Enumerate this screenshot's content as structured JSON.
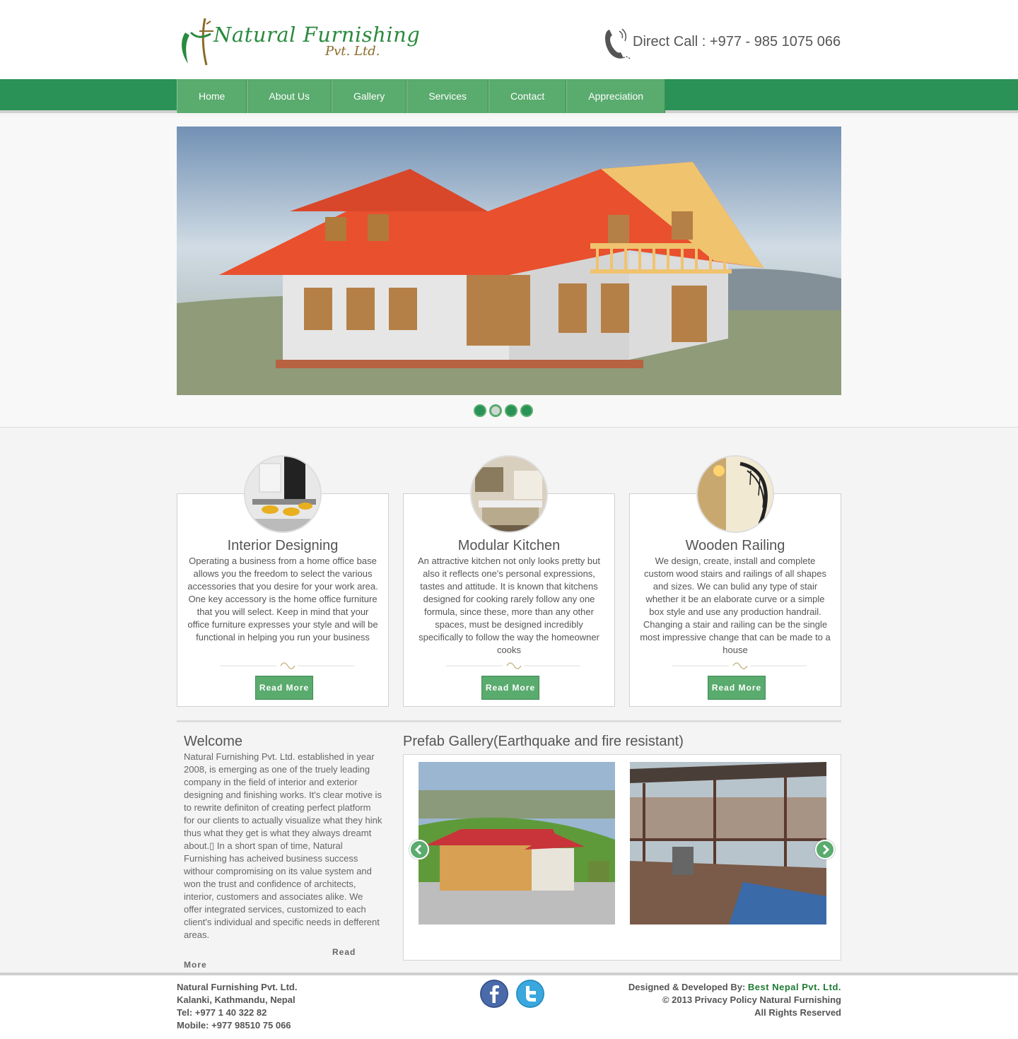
{
  "header": {
    "logo_main": "Natural Furnishing",
    "logo_sub": "Pvt. Ltd.",
    "direct_call": "Direct Call : +977 - 985 1075 066"
  },
  "nav": [
    "Home",
    "About Us",
    "Gallery",
    "Services",
    "Contact",
    "Appreciation"
  ],
  "slider": {
    "dots": 4,
    "active_dot": 2
  },
  "features": [
    {
      "title": "Interior Designing",
      "text": "Operating a business from a home office base allows you the freedom to select the various accessories that you desire for your work area. One key accessory is the home office furniture that you will select. Keep in mind that your office furniture expresses your style and will be functional in helping you run your business",
      "button": "Read More"
    },
    {
      "title": "Modular Kitchen",
      "text": "An attractive kitchen not only looks pretty but also it reflects one's personal expressions, tastes and attitude. It is known that kitchens designed for cooking rarely follow any one formula, since these, more than any other spaces, must be designed incredibly specifically to follow the way the homeowner cooks",
      "button": "Read More"
    },
    {
      "title": "Wooden Railing",
      "text": "We design, create, install and complete custom wood stairs and railings of all shapes and sizes. We can bulid any type of stair whether it be an elaborate curve or a simple box style and use any production handrail. Changing a stair and railing can be the single most impressive change that can be made to a house",
      "button": "Read More"
    }
  ],
  "welcome": {
    "title": "Welcome",
    "text": "Natural Furnishing Pvt. Ltd. established in year 2008, is emerging as one of the truely leading company in the field of interior and exterior designing and finishing works. It's clear motive is to rewrite definiton of creating perfect platform for our clients to actually visualize what they hink thus what they get is what they always dreamt about.▯ In a short span of time, Natural Furnishing has acheived business success withour compromising on its value system and won the trust and confidence of architects, interior, customers and associates alike. We offer integrated services, customized to each client's individual and specific needs in defferent areas.",
    "read": "Read",
    "more": "More"
  },
  "gallery": {
    "title": "Prefab Gallery(Earthquake and fire resistant)"
  },
  "footer": {
    "company": "Natural Furnishing Pvt. Ltd.",
    "address": "Kalanki, Kathmandu, Nepal",
    "tel": "Tel: +977 1 40 322 82",
    "mobile": "Mobile: +977 98510 75 066",
    "designed_by": "Designed & Developed By:",
    "developer": "Best Nepal Pvt. Ltd.",
    "copyright": "© 2013 Privacy Policy Natural Furnishing",
    "rights": "All Rights Reserved"
  },
  "colors": {
    "brand_green": "#2a9257",
    "button_green": "#5aab6e",
    "link_green": "#1e7a33"
  },
  "icons": [
    "phone-icon",
    "facebook-icon",
    "twitter-icon",
    "prev-arrow-icon",
    "next-arrow-icon"
  ]
}
